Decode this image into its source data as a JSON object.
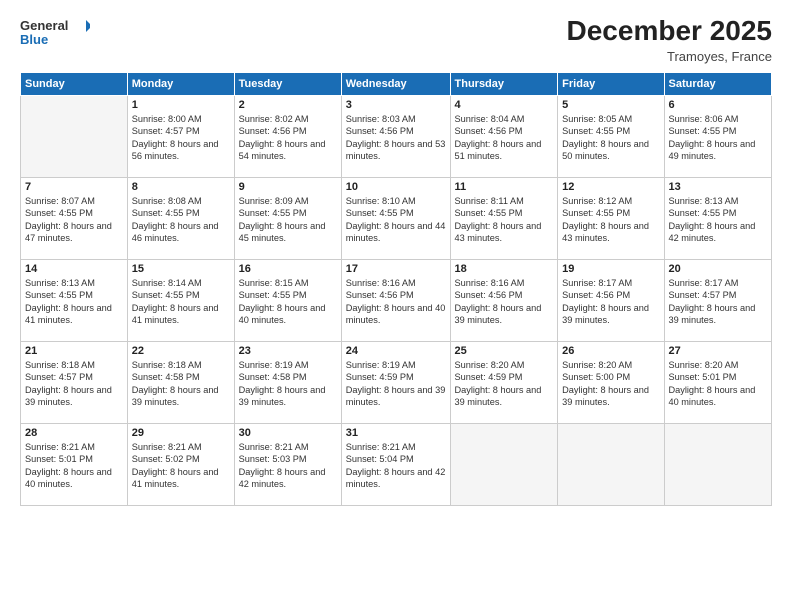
{
  "logo": {
    "general": "General",
    "blue": "Blue"
  },
  "header": {
    "month": "December 2025",
    "location": "Tramoyes, France"
  },
  "weekdays": [
    "Sunday",
    "Monday",
    "Tuesday",
    "Wednesday",
    "Thursday",
    "Friday",
    "Saturday"
  ],
  "weeks": [
    [
      {
        "day": "",
        "sunrise": "",
        "sunset": "",
        "daylight": ""
      },
      {
        "day": "1",
        "sunrise": "8:00 AM",
        "sunset": "4:57 PM",
        "daylight": "8 hours and 56 minutes."
      },
      {
        "day": "2",
        "sunrise": "8:02 AM",
        "sunset": "4:56 PM",
        "daylight": "8 hours and 54 minutes."
      },
      {
        "day": "3",
        "sunrise": "8:03 AM",
        "sunset": "4:56 PM",
        "daylight": "8 hours and 53 minutes."
      },
      {
        "day": "4",
        "sunrise": "8:04 AM",
        "sunset": "4:56 PM",
        "daylight": "8 hours and 51 minutes."
      },
      {
        "day": "5",
        "sunrise": "8:05 AM",
        "sunset": "4:55 PM",
        "daylight": "8 hours and 50 minutes."
      },
      {
        "day": "6",
        "sunrise": "8:06 AM",
        "sunset": "4:55 PM",
        "daylight": "8 hours and 49 minutes."
      }
    ],
    [
      {
        "day": "7",
        "sunrise": "8:07 AM",
        "sunset": "4:55 PM",
        "daylight": "8 hours and 47 minutes."
      },
      {
        "day": "8",
        "sunrise": "8:08 AM",
        "sunset": "4:55 PM",
        "daylight": "8 hours and 46 minutes."
      },
      {
        "day": "9",
        "sunrise": "8:09 AM",
        "sunset": "4:55 PM",
        "daylight": "8 hours and 45 minutes."
      },
      {
        "day": "10",
        "sunrise": "8:10 AM",
        "sunset": "4:55 PM",
        "daylight": "8 hours and 44 minutes."
      },
      {
        "day": "11",
        "sunrise": "8:11 AM",
        "sunset": "4:55 PM",
        "daylight": "8 hours and 43 minutes."
      },
      {
        "day": "12",
        "sunrise": "8:12 AM",
        "sunset": "4:55 PM",
        "daylight": "8 hours and 43 minutes."
      },
      {
        "day": "13",
        "sunrise": "8:13 AM",
        "sunset": "4:55 PM",
        "daylight": "8 hours and 42 minutes."
      }
    ],
    [
      {
        "day": "14",
        "sunrise": "8:13 AM",
        "sunset": "4:55 PM",
        "daylight": "8 hours and 41 minutes."
      },
      {
        "day": "15",
        "sunrise": "8:14 AM",
        "sunset": "4:55 PM",
        "daylight": "8 hours and 41 minutes."
      },
      {
        "day": "16",
        "sunrise": "8:15 AM",
        "sunset": "4:55 PM",
        "daylight": "8 hours and 40 minutes."
      },
      {
        "day": "17",
        "sunrise": "8:16 AM",
        "sunset": "4:56 PM",
        "daylight": "8 hours and 40 minutes."
      },
      {
        "day": "18",
        "sunrise": "8:16 AM",
        "sunset": "4:56 PM",
        "daylight": "8 hours and 39 minutes."
      },
      {
        "day": "19",
        "sunrise": "8:17 AM",
        "sunset": "4:56 PM",
        "daylight": "8 hours and 39 minutes."
      },
      {
        "day": "20",
        "sunrise": "8:17 AM",
        "sunset": "4:57 PM",
        "daylight": "8 hours and 39 minutes."
      }
    ],
    [
      {
        "day": "21",
        "sunrise": "8:18 AM",
        "sunset": "4:57 PM",
        "daylight": "8 hours and 39 minutes."
      },
      {
        "day": "22",
        "sunrise": "8:18 AM",
        "sunset": "4:58 PM",
        "daylight": "8 hours and 39 minutes."
      },
      {
        "day": "23",
        "sunrise": "8:19 AM",
        "sunset": "4:58 PM",
        "daylight": "8 hours and 39 minutes."
      },
      {
        "day": "24",
        "sunrise": "8:19 AM",
        "sunset": "4:59 PM",
        "daylight": "8 hours and 39 minutes."
      },
      {
        "day": "25",
        "sunrise": "8:20 AM",
        "sunset": "4:59 PM",
        "daylight": "8 hours and 39 minutes."
      },
      {
        "day": "26",
        "sunrise": "8:20 AM",
        "sunset": "5:00 PM",
        "daylight": "8 hours and 39 minutes."
      },
      {
        "day": "27",
        "sunrise": "8:20 AM",
        "sunset": "5:01 PM",
        "daylight": "8 hours and 40 minutes."
      }
    ],
    [
      {
        "day": "28",
        "sunrise": "8:21 AM",
        "sunset": "5:01 PM",
        "daylight": "8 hours and 40 minutes."
      },
      {
        "day": "29",
        "sunrise": "8:21 AM",
        "sunset": "5:02 PM",
        "daylight": "8 hours and 41 minutes."
      },
      {
        "day": "30",
        "sunrise": "8:21 AM",
        "sunset": "5:03 PM",
        "daylight": "8 hours and 42 minutes."
      },
      {
        "day": "31",
        "sunrise": "8:21 AM",
        "sunset": "5:04 PM",
        "daylight": "8 hours and 42 minutes."
      },
      {
        "day": "",
        "sunrise": "",
        "sunset": "",
        "daylight": ""
      },
      {
        "day": "",
        "sunrise": "",
        "sunset": "",
        "daylight": ""
      },
      {
        "day": "",
        "sunrise": "",
        "sunset": "",
        "daylight": ""
      }
    ]
  ]
}
